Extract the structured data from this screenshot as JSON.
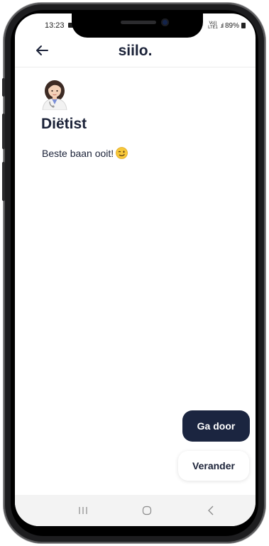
{
  "status_bar": {
    "time": "13:23",
    "network_top": "Vo))",
    "network_bottom": "LTE1",
    "signal": ".ıl",
    "battery": "89%"
  },
  "header": {
    "logo": "siilo.",
    "back_icon": "arrow-left-icon"
  },
  "profile": {
    "avatar_icon": "woman-health-worker-emoji",
    "title": "Diëtist",
    "message": "Beste baan ooit!",
    "message_emoji": "winking-face-emoji"
  },
  "actions": {
    "primary_label": "Ga door",
    "secondary_label": "Verander"
  },
  "navbar": {
    "icons": [
      "recent-apps-icon",
      "home-icon",
      "back-icon"
    ]
  },
  "colors": {
    "brand_navy": "#1b2540",
    "text": "#1b2238",
    "navbar_bg": "#f3f3f3"
  }
}
